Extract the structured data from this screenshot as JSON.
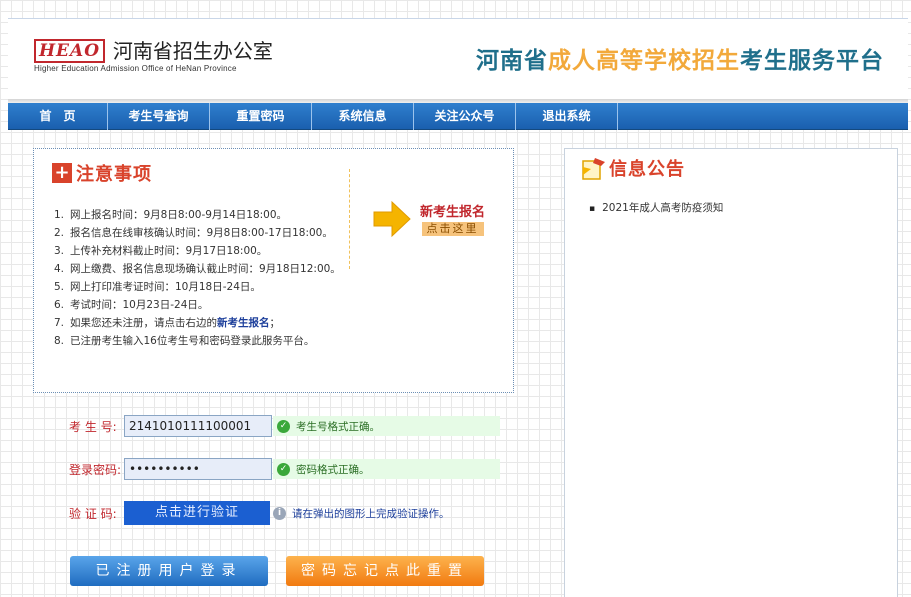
{
  "header": {
    "logo_badge": "HEAO",
    "logo_title": "河南省招生办公室",
    "logo_subtitle": "Higher Education Admission Office of HeNan Province",
    "platform_part1": "河南省",
    "platform_part2": "成人高等学校招生",
    "platform_part3": "考生服务平台"
  },
  "nav": {
    "items": [
      {
        "label": "首　页"
      },
      {
        "label": "考生号查询"
      },
      {
        "label": "重置密码"
      },
      {
        "label": "系统信息"
      },
      {
        "label": "关注公众号"
      },
      {
        "label": "退出系统"
      }
    ]
  },
  "notice": {
    "title": "注意事项",
    "items": [
      {
        "num": "1.",
        "text": "网上报名时间：9月8日8:00-9月14日18:00。"
      },
      {
        "num": "2.",
        "text": "报名信息在线审核确认时间：9月8日8:00-17日18:00。"
      },
      {
        "num": "3.",
        "text": "上传补充材料截止时间：9月17日18:00。"
      },
      {
        "num": "4.",
        "text": "网上缴费、报名信息现场确认截止时间：9月18日12:00。"
      },
      {
        "num": "5.",
        "text": "网上打印准考证时间：10月18日-24日。"
      },
      {
        "num": "6.",
        "text": "考试时间：10月23日-24日。"
      },
      {
        "num": "7.",
        "text_before": "如果您还未注册，请点击右边的",
        "text_link": "新考生报名",
        "text_after": "；"
      },
      {
        "num": "8.",
        "text": "已注册考生输入16位考生号和密码登录此服务平台。"
      }
    ],
    "new_reg_title": "新考生报名",
    "new_reg_button": "点击这里"
  },
  "form": {
    "exam_label": "考 生 号:",
    "exam_value": "2141010111100001",
    "exam_status": "考生号格式正确。",
    "password_label": "登录密码:",
    "password_value": "••••••••••",
    "password_status": "密码格式正确。",
    "captcha_label": "验 证 码:",
    "captcha_button": "点击进行验证",
    "captcha_hint": "请在弹出的图形上完成验证操作。",
    "login_button": "已注册用户登录",
    "reset_button": "密码忘记点此重置"
  },
  "announcements": {
    "title": "信息公告",
    "items": [
      "2021年成人高考防疫须知"
    ]
  },
  "colors": {
    "nav_blue": "#1a5fae",
    "accent_red": "#d9432b",
    "login_blue": "#1f6cc0",
    "reset_orange": "#f17a10"
  }
}
